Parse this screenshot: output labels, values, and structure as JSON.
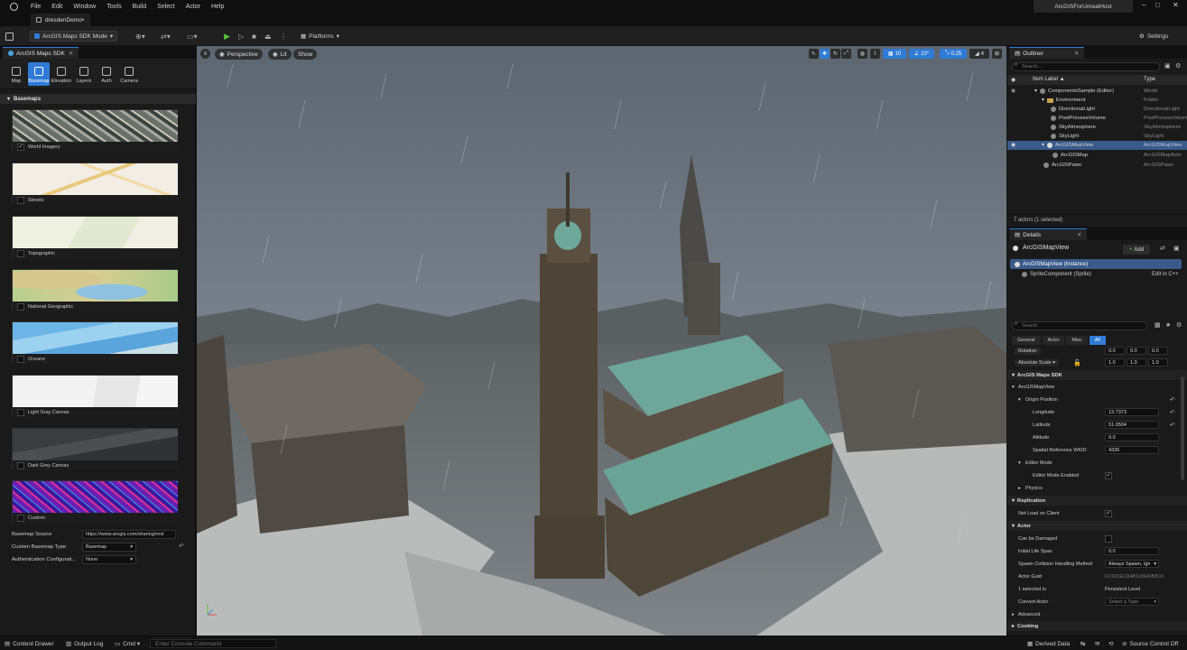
{
  "menu": {
    "items": [
      "File",
      "Edit",
      "Window",
      "Tools",
      "Build",
      "Select",
      "Actor",
      "Help"
    ],
    "host": "ArcGISForUnrealHost"
  },
  "tab": {
    "name": "dresdenDemo•"
  },
  "toolbar": {
    "mode": "ArcGIS Maps SDK Mode",
    "platforms": "Platforms",
    "settings": "Settings"
  },
  "left": {
    "tab": "ArcGIS Maps SDK",
    "tools": [
      "Map",
      "Basemap",
      "Elevation",
      "Layers",
      "Auth",
      "Camera"
    ],
    "section": "Basemaps",
    "basemaps": [
      {
        "label": "World Imagery",
        "checked": true
      },
      {
        "label": "Streets",
        "checked": false
      },
      {
        "label": "Topographic",
        "checked": false
      },
      {
        "label": "National Geographic",
        "checked": false
      },
      {
        "label": "Oceans",
        "checked": false
      },
      {
        "label": "Light Gray Canvas",
        "checked": false
      },
      {
        "label": "Dark Grey Canvas",
        "checked": false
      },
      {
        "label": "Custom",
        "checked": false
      }
    ],
    "props": {
      "source_label": "Basemap Source",
      "source_value": "https://www.arcgis.com/sharing/rest",
      "type_label": "Custom Basemap Type",
      "type_value": "Basemap",
      "auth_label": "Authentication Configurati...",
      "auth_value": "None"
    }
  },
  "viewport": {
    "perspective": "Perspective",
    "lit": "Lit",
    "show": "Show",
    "grid": "10",
    "angle": "10°",
    "scale": "0.25",
    "cams": "4"
  },
  "outliner": {
    "tab": "Outliner",
    "search": "Search...",
    "col_label": "Item Label ▲",
    "col_type": "Type",
    "rows": [
      {
        "name": "ComponentsSample (Editor)",
        "type": "World"
      },
      {
        "name": "Environment",
        "type": "Folder"
      },
      {
        "name": "DirectionalLight",
        "type": "DirectionalLight"
      },
      {
        "name": "PostProcessVolume",
        "type": "PostProcessVolume"
      },
      {
        "name": "SkyAtmosphere",
        "type": "SkyAtmosphere"
      },
      {
        "name": "SkyLight",
        "type": "SkyLight"
      },
      {
        "name": "ArcGISMapView",
        "type": "ArcGISMapView"
      },
      {
        "name": "ArcGISMap",
        "type": "ArcGISMapActo"
      },
      {
        "name": "ArcGISPawn",
        "type": "ArcGISPawn"
      }
    ],
    "footer": "7 actors (1 selected)"
  },
  "details": {
    "tab": "Details",
    "title": "ArcGISMapView",
    "add": "Add",
    "instance": "ArcGISMapView (Instance)",
    "sprite": "SpriteComponent (Sprite)",
    "edit": "Edit in C++",
    "search": "Search",
    "filters": [
      "General",
      "Actor",
      "Misc",
      "All"
    ],
    "rotation": "Rotation",
    "rot_vals": [
      "0.0",
      "0.0",
      "0.0"
    ],
    "absolute_scale": "Absolute Scale",
    "scale_vals": [
      "1.0",
      "1.0",
      "1.0"
    ],
    "sec_sdk": "ArcGIS Maps SDK",
    "sec_mapview": "ArcGISMapView",
    "origin": "Origin Position",
    "longitude_label": "Longitude",
    "longitude": "13.7373",
    "latitude_label": "Latitude",
    "latitude": "51.0504",
    "altitude_label": "Altitude",
    "altitude": "0.0",
    "wkid_label": "Spatial Reference WKID",
    "wkid": "4326",
    "editor_mode": "Editor Mode",
    "editor_enabled": "Editor Mode Enabled",
    "physics": "Physics",
    "replication": "Replication",
    "net_load": "Net Load on Client",
    "actor": "Actor",
    "can_damage": "Can be Damaged",
    "life_label": "Initial Life Span",
    "life": "0.0",
    "spawn_label": "Spawn Collision Handling Method",
    "spawn": "Always Spawn, Ign",
    "guid_label": "Actor Guid",
    "guid": "FC665EC848918540B8C0",
    "selected_label": "1 selected in",
    "selected_value": "Persistent Level",
    "convert_label": "Convert Actor",
    "convert_value": "Select a Type",
    "advanced": "Advanced",
    "cooking": "Cooking"
  },
  "status": {
    "content": "Content Drawer",
    "output": "Output Log",
    "cmd": "Cmd",
    "console": "Enter Console Command",
    "derived": "Derived Data",
    "source": "Source Control Off"
  }
}
